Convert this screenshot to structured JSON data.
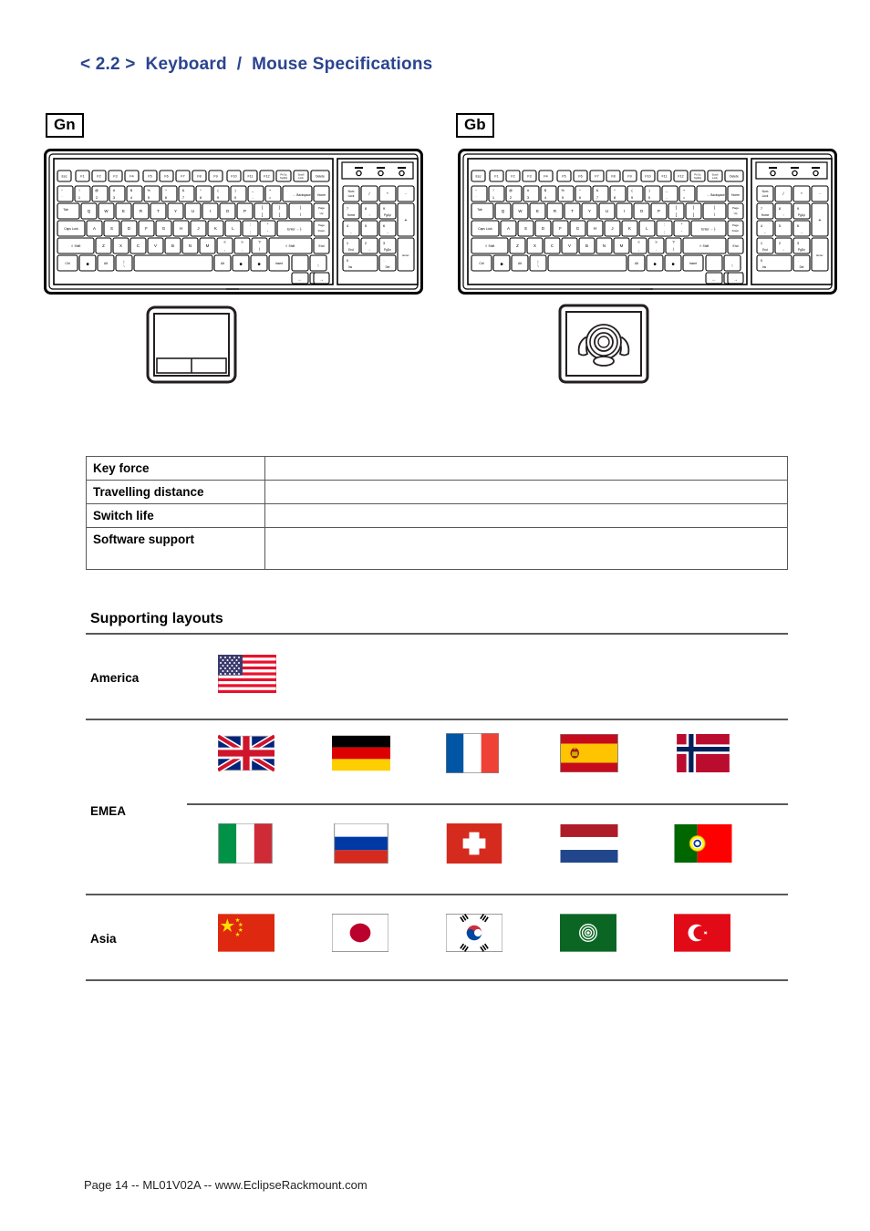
{
  "page": {
    "title": "< 2.2 >  Keyboard  /  Mouse Specifications",
    "title_color": "#2b4490",
    "footer": "Page 14 -- ML01V02A -- www.EclipseRackmount.com"
  },
  "devices": [
    {
      "tag": "Gn",
      "pointer": "touchpad"
    },
    {
      "tag": "Gb",
      "pointer": "trackball"
    }
  ],
  "keyboard": {
    "indicators": [
      "Num",
      "Caps",
      "Scroll"
    ],
    "rows": [
      [
        "Esc",
        "F1",
        "F2",
        "F3",
        "F4",
        "F5",
        "F6",
        "F7",
        "F8",
        "F9",
        "F10",
        "F11",
        "F12",
        "Prt Sc SysRq",
        "Scroll Lock",
        "Pause Break",
        "Delete"
      ],
      [
        "~ `",
        "! 1",
        "@ 2",
        "# 3",
        "$ 4",
        "% 5",
        "^ 6",
        "& 7",
        "* 8",
        "( 9",
        ") 0",
        "_ -",
        "+ =",
        "Backspace",
        "Home"
      ],
      [
        "Tab",
        "Q",
        "W",
        "E",
        "R",
        "T",
        "Y",
        "U",
        "I",
        "O",
        "P",
        "{ [",
        "} ]",
        "| \\",
        "Page Up"
      ],
      [
        "Caps Lock",
        "A",
        "S",
        "D",
        "F",
        "G",
        "H",
        "J",
        "K",
        "L",
        ": ;",
        "\" '",
        "Enter",
        "Page Down"
      ],
      [
        "Shift",
        "Z",
        "X",
        "C",
        "V",
        "B",
        "N",
        "M",
        "< ,",
        "> .",
        "? /",
        "Shift",
        "End"
      ],
      [
        "Ctrl",
        "Win",
        "Alt",
        "\\",
        "Space",
        "Alt",
        "Win",
        "Menu",
        "Ctrl",
        "Up",
        "Left",
        "Down",
        "Right"
      ]
    ],
    "numpad": [
      [
        "Num Lock",
        "/",
        "*",
        "-"
      ],
      [
        "7 Home",
        "8",
        "9 PgUp",
        "+"
      ],
      [
        "4",
        "5",
        "6"
      ],
      [
        "1 End",
        "2",
        "3 PgDn",
        "Enter"
      ],
      [
        "0 Ins",
        ". Del"
      ]
    ]
  },
  "spec_table": {
    "rows": [
      {
        "label": "Key force",
        "value": ""
      },
      {
        "label": "Travelling distance",
        "value": ""
      },
      {
        "label": "Switch life",
        "value": ""
      },
      {
        "label": "Software support",
        "value": ""
      }
    ]
  },
  "layouts": {
    "heading": "Supporting layouts",
    "regions": [
      {
        "name": "America",
        "rows": [
          [
            {
              "country": "United States",
              "code": "us"
            }
          ]
        ]
      },
      {
        "name": "EMEA",
        "rows": [
          [
            {
              "country": "United Kingdom",
              "code": "gb"
            },
            {
              "country": "Germany",
              "code": "de"
            },
            {
              "country": "France",
              "code": "fr"
            },
            {
              "country": "Spain",
              "code": "es"
            },
            {
              "country": "Norway",
              "code": "no"
            }
          ],
          [
            {
              "country": "Italy",
              "code": "it"
            },
            {
              "country": "Russia",
              "code": "ru"
            },
            {
              "country": "Switzerland",
              "code": "ch"
            },
            {
              "country": "Netherlands",
              "code": "nl"
            },
            {
              "country": "Portugal",
              "code": "pt"
            }
          ]
        ]
      },
      {
        "name": "Asia",
        "rows": [
          [
            {
              "country": "China",
              "code": "cn"
            },
            {
              "country": "Japan",
              "code": "jp"
            },
            {
              "country": "South Korea",
              "code": "kr"
            },
            {
              "country": "Arab League",
              "code": "arab"
            },
            {
              "country": "Turkey",
              "code": "tr"
            }
          ]
        ]
      }
    ]
  },
  "colors": {
    "title_blue": "#2b4490",
    "rule_gray": "#58595b",
    "flag_red": "#d52b1e",
    "flag_blue": "#0039a6",
    "flag_green": "#009246"
  }
}
